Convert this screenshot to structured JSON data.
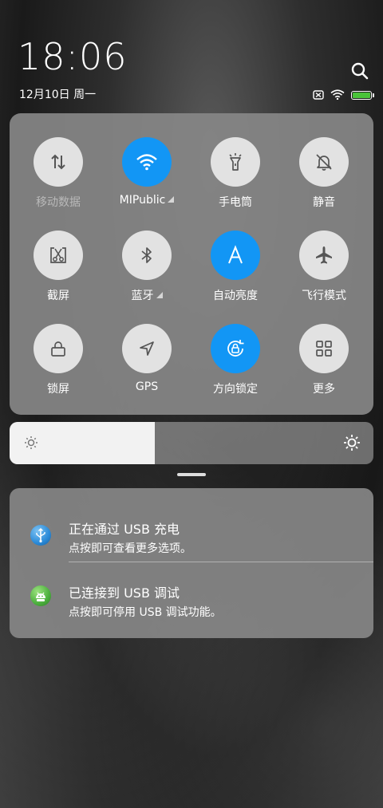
{
  "header": {
    "time": "18:06",
    "date": "12月10日 周一",
    "search_icon": "search-icon"
  },
  "status_bar": {
    "icons": [
      "sim-off-icon",
      "wifi-icon",
      "battery-icon"
    ],
    "battery_level": 1.0,
    "battery_color": "#4ac33a"
  },
  "quick_settings": {
    "accent_color": "#1296f5",
    "tiles": [
      {
        "label": "移动数据",
        "icon": "mobile-data-icon",
        "active": false,
        "disabled": true
      },
      {
        "label": "MIPublic",
        "icon": "wifi-icon",
        "active": true,
        "has_menu": true
      },
      {
        "label": "手电筒",
        "icon": "flashlight-icon",
        "active": false
      },
      {
        "label": "静音",
        "icon": "mute-bell-icon",
        "active": false
      },
      {
        "label": "截屏",
        "icon": "screenshot-icon",
        "active": false
      },
      {
        "label": "蓝牙",
        "icon": "bluetooth-icon",
        "active": false,
        "has_menu": true
      },
      {
        "label": "自动亮度",
        "icon": "auto-brightness-icon",
        "active": true
      },
      {
        "label": "飞行模式",
        "icon": "airplane-icon",
        "active": false
      },
      {
        "label": "锁屏",
        "icon": "lock-icon",
        "active": false
      },
      {
        "label": "GPS",
        "icon": "gps-icon",
        "active": false
      },
      {
        "label": "方向锁定",
        "icon": "rotation-lock-icon",
        "active": true
      },
      {
        "label": "更多",
        "icon": "more-grid-icon",
        "active": false
      }
    ]
  },
  "brightness": {
    "level": 0.4,
    "icons": [
      "sun-low-icon",
      "sun-high-icon"
    ]
  },
  "notifications": [
    {
      "title": "正在通过 USB 充电",
      "text": "点按即可查看更多选项。",
      "icon": "usb-icon",
      "icon_color": "#2a8ad8"
    },
    {
      "title": "已连接到 USB 调试",
      "text": "点按即可停用 USB 调试功能。",
      "icon": "android-icon",
      "icon_color": "#4caf3e"
    }
  ]
}
